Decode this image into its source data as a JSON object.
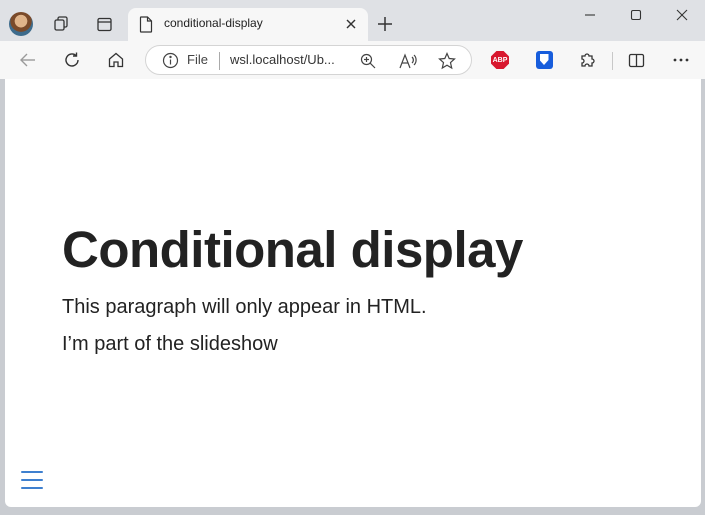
{
  "browser": {
    "tab": {
      "title": "conditional-display"
    },
    "address": {
      "scheme_label": "File",
      "url": "wsl.localhost/Ub..."
    },
    "extensions": {
      "abp_label": "ABP"
    }
  },
  "page": {
    "heading": "Conditional display",
    "paragraphs": [
      "This paragraph will only appear in HTML.",
      "I’m part of the slideshow"
    ]
  },
  "colors": {
    "accent": "#3f80cf",
    "text": "#222222",
    "tabstrip": "#dfe1e5",
    "toolbar": "#f7f7f7"
  }
}
